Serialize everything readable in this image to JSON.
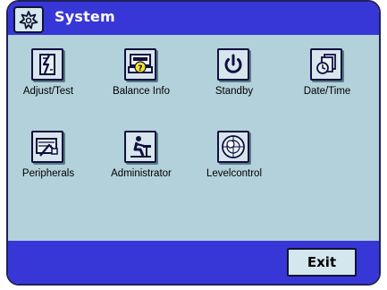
{
  "window": {
    "title": "System"
  },
  "icons": {
    "title": "flower-gear-icon"
  },
  "tiles": [
    {
      "label": "Adjust/Test",
      "icon": "adjust-test-icon"
    },
    {
      "label": "Balance Info",
      "icon": "balance-info-icon"
    },
    {
      "label": "Standby",
      "icon": "power-icon"
    },
    {
      "label": "Date/Time",
      "icon": "date-time-icon"
    },
    {
      "label": "Peripherals",
      "icon": "peripherals-icon"
    },
    {
      "label": "Administrator",
      "icon": "administrator-icon"
    },
    {
      "label": "Levelcontrol",
      "icon": "level-control-icon"
    }
  ],
  "bottom": {
    "exit_label": "Exit"
  },
  "colors": {
    "bar": "#3737d8",
    "background": "#b3d1da",
    "button": "#d7e6ec"
  }
}
